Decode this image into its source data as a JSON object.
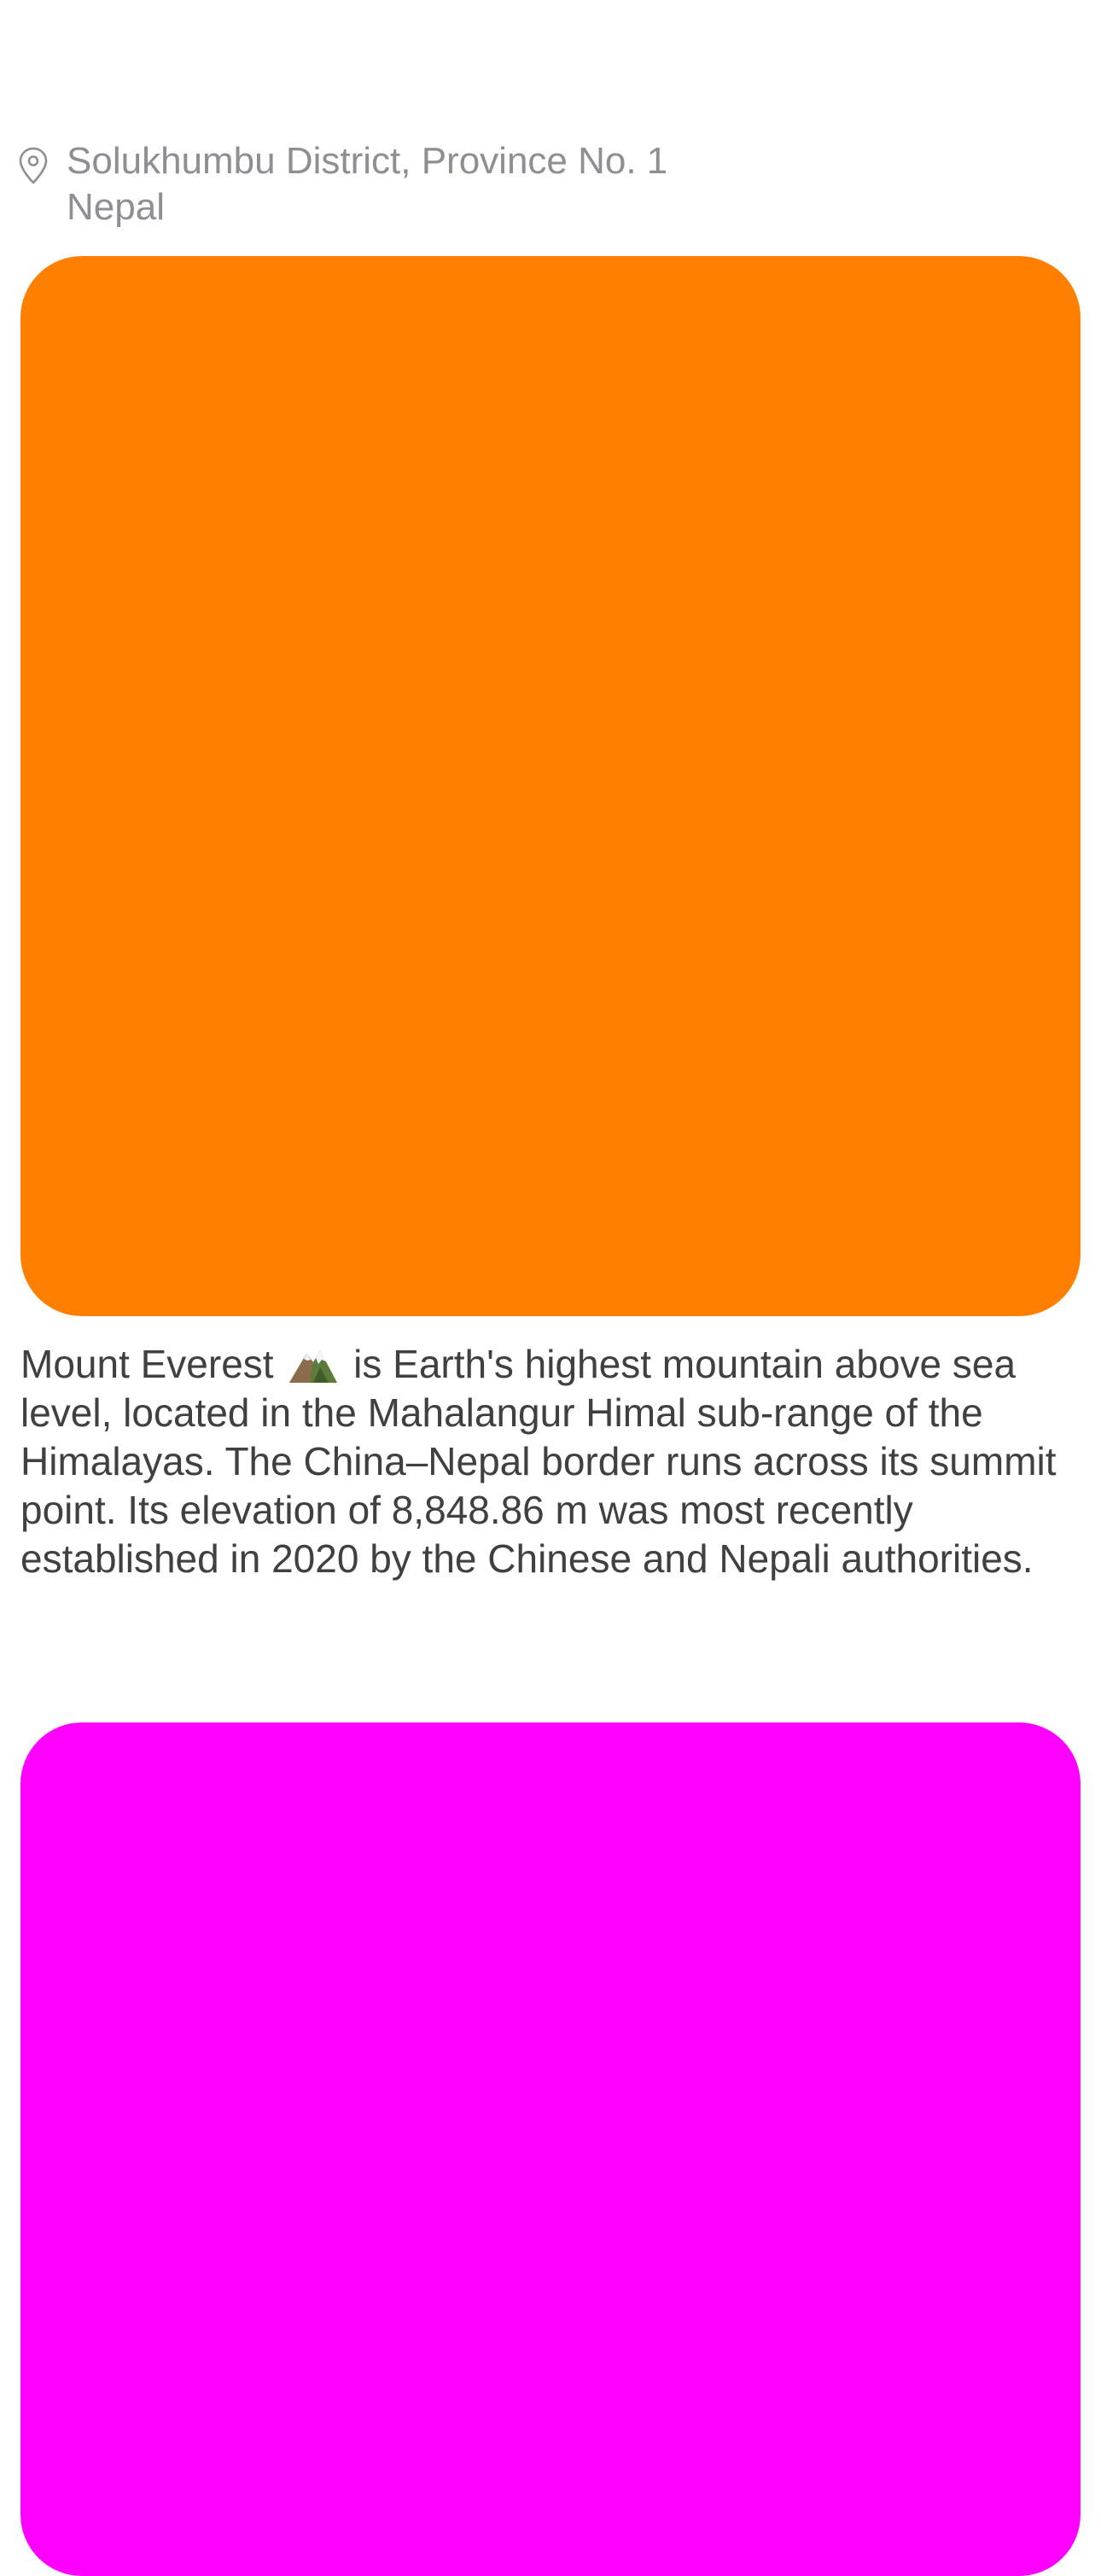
{
  "location": {
    "line1": "Solukhumbu District, Province No. 1",
    "line2": "Nepal",
    "icon": "map-pin-icon"
  },
  "cards": [
    {
      "color": "#ff8000"
    },
    {
      "color": "#ff00ff"
    }
  ],
  "description": {
    "before_icon": "Mount Everest",
    "icon": "mountain-emoji-icon",
    "after_icon": "is Earth's highest mountain above sea level, located in the Mahalangur Himal sub-range of the Himalayas. The China–Nepal border runs across its summit point. Its elevation of 8,848.86 m was most recently established in 2020 by the Chinese and Nepali authorities."
  },
  "colors": {
    "secondary_text": "#8e8e93",
    "body_text": "#404040",
    "background": "#ffffff"
  }
}
